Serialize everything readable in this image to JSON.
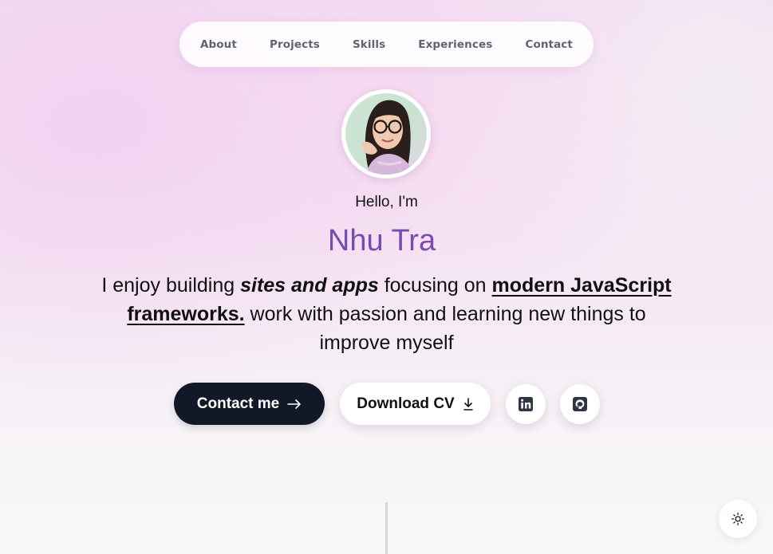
{
  "nav": {
    "items": [
      {
        "label": "About"
      },
      {
        "label": "Projects"
      },
      {
        "label": "Skills"
      },
      {
        "label": "Experiences"
      },
      {
        "label": "Contact"
      }
    ]
  },
  "hero": {
    "greeting": "Hello, I'm",
    "name": "Nhu Tra",
    "tagline": {
      "part1": "I enjoy building ",
      "emphasis": "sites and apps",
      "part2": " focusing on ",
      "underline": "modern JavaScript frameworks.",
      "part3": " work with passion and learning new things to improve myself"
    },
    "name_color": "#7b4ab0"
  },
  "actions": {
    "contact_label": "Contact me",
    "cv_label": "Download CV",
    "linkedin_icon": "linkedin-icon",
    "github_icon": "github-icon"
  },
  "theme_toggle": {
    "icon": "sun-icon"
  }
}
